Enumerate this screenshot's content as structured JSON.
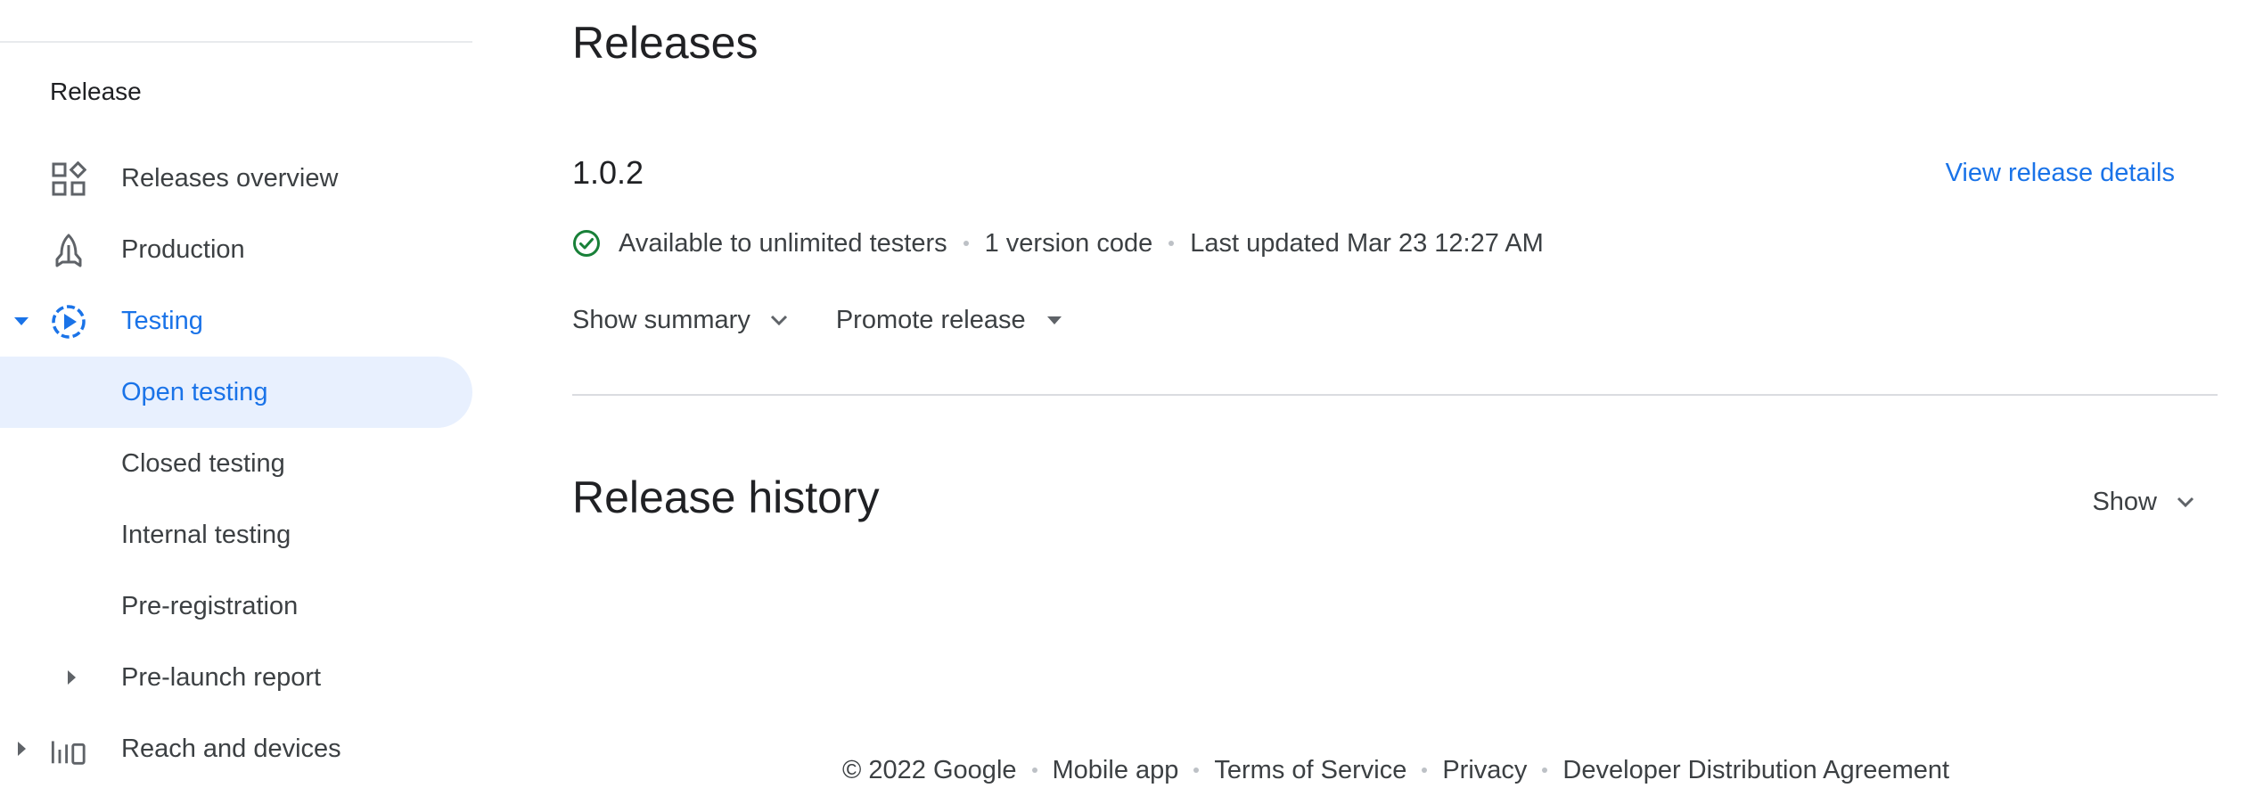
{
  "sidebar": {
    "section_heading": "Release",
    "items": [
      {
        "label": "Releases overview",
        "icon": "dashboard-icon"
      },
      {
        "label": "Production",
        "icon": "rocket-icon"
      },
      {
        "label": "Testing",
        "icon": "testing-play-icon",
        "expanded": true
      },
      {
        "label": "Open testing",
        "selected": true
      },
      {
        "label": "Closed testing"
      },
      {
        "label": "Internal testing"
      },
      {
        "label": "Pre-registration"
      },
      {
        "label": "Pre-launch report",
        "expandable": true
      },
      {
        "label": "Reach and devices",
        "icon": "bar-chart-device-icon",
        "expandable": true
      }
    ]
  },
  "main": {
    "title": "Releases",
    "release": {
      "version": "1.0.2",
      "view_details_label": "View release details",
      "status": "Available to unlimited testers",
      "version_codes": "1 version code",
      "last_updated": "Last updated Mar 23 12:27 AM",
      "show_summary_label": "Show summary",
      "promote_label": "Promote release"
    },
    "history": {
      "title": "Release history",
      "show_label": "Show"
    }
  },
  "footer": {
    "copyright": "© 2022 Google",
    "links": [
      "Mobile app",
      "Terms of Service",
      "Privacy",
      "Developer Distribution Agreement"
    ]
  },
  "colors": {
    "accent": "#1a73e8",
    "selected_bg": "#e8f0fe",
    "success": "#188038",
    "text_secondary": "#3c4043"
  }
}
